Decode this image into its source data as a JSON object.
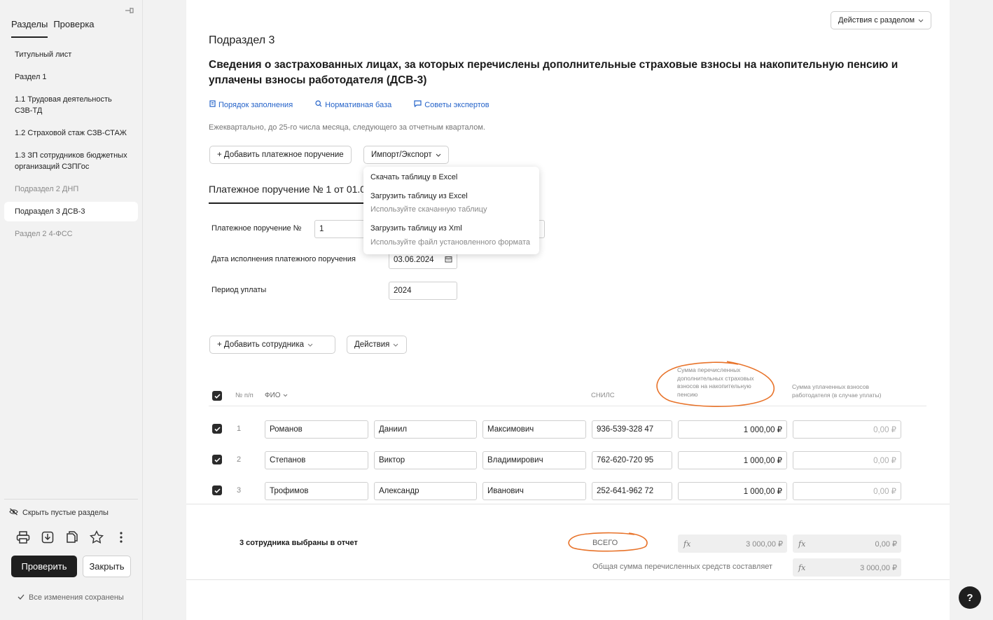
{
  "sidebar": {
    "tabs": [
      "Разделы",
      "Проверка"
    ],
    "items": [
      {
        "label": "Титульный лист"
      },
      {
        "label": "Раздел 1"
      },
      {
        "label": "1.1 Трудовая деятельность СЗВ-ТД"
      },
      {
        "label": "1.2 Страховой стаж СЗВ-СТАЖ"
      },
      {
        "label": "1.3 ЗП сотрудников бюджетных организаций СЗПГос"
      },
      {
        "label": "Подраздел 2 ДНП"
      },
      {
        "label": "Подраздел 3 ДСВ-3"
      },
      {
        "label": "Раздел 2 4-ФСС"
      }
    ],
    "hide_empty": "Скрыть пустые разделы",
    "check_button": "Проверить",
    "close_button": "Закрыть",
    "saved_status": "Все изменения сохранены"
  },
  "main": {
    "section_actions": "Действия с разделом",
    "subsection": "Подраздел 3",
    "heading": "Сведения о застрахованных лицах, за которых перечислены дополнительные страховые взносы на накопительную пенсию и уплачены взносы работодателя (ДСВ-3)",
    "links": [
      "Порядок заполнения",
      "Нормативная база",
      "Советы экспертов"
    ],
    "note": "Ежеквартально, до 25-го числа месяца, следующего за отчетным кварталом.",
    "add_payment_button": "+ Добавить платежное поручение",
    "import_export_button": "Импорт/Экспорт",
    "menu": {
      "item1": "Скачать таблицу в Excel",
      "item2": "Загрузить таблицу из Excel",
      "item2_sub": "Используйте скачанную таблицу",
      "item3": "Загрузить таблицу из Xml",
      "item3_sub": "Используйте файл установленного формата"
    },
    "payment_title": "Платежное поручение № 1 от 01.0",
    "form": {
      "pp_label": "Платежное поручение №",
      "pp_value": "1",
      "date_label": "Дата исполнения платежного поручения",
      "date_value": "03.06.2024",
      "period_label": "Период уплаты",
      "period_value": "2024"
    },
    "add_employee_button": "+ Добавить сотрудника",
    "actions_button": "Действия",
    "table": {
      "headers": {
        "num": "№ п/п",
        "fio": "ФИО",
        "snils": "СНИЛС",
        "sum_additional": "Сумма перечисленных дополнительных страховых взносов на накопительную пенсию",
        "sum_employer": "Сумма уплаченных взносов работодателя (в случае уплаты)"
      },
      "rows": [
        {
          "num": "1",
          "last": "Романов",
          "first": "Даниил",
          "middle": "Максимович",
          "snils": "936-539-328 47",
          "sum": "1 000,00 ₽",
          "employer": "0,00 ₽"
        },
        {
          "num": "2",
          "last": "Степанов",
          "first": "Виктор",
          "middle": "Владимирович",
          "snils": "762-620-720 95",
          "sum": "1 000,00 ₽",
          "employer": "0,00 ₽"
        },
        {
          "num": "3",
          "last": "Трофимов",
          "first": "Александр",
          "middle": "Иванович",
          "snils": "252-641-962 72",
          "sum": "1 000,00 ₽",
          "employer": "0,00 ₽"
        }
      ]
    },
    "summary": {
      "selected": "3 сотрудника выбраны в отчет",
      "total_label": "ВСЕГО",
      "total_sum": "3 000,00 ₽",
      "total_employer": "0,00 ₽",
      "overall_label": "Общая сумма перечисленных средств составляет",
      "overall_sum": "3 000,00 ₽",
      "fx": "fx"
    }
  },
  "help": "?",
  "colors": {
    "link": "#2563c9",
    "annotation": "#e8732a",
    "dark": "#1f1f1f"
  }
}
